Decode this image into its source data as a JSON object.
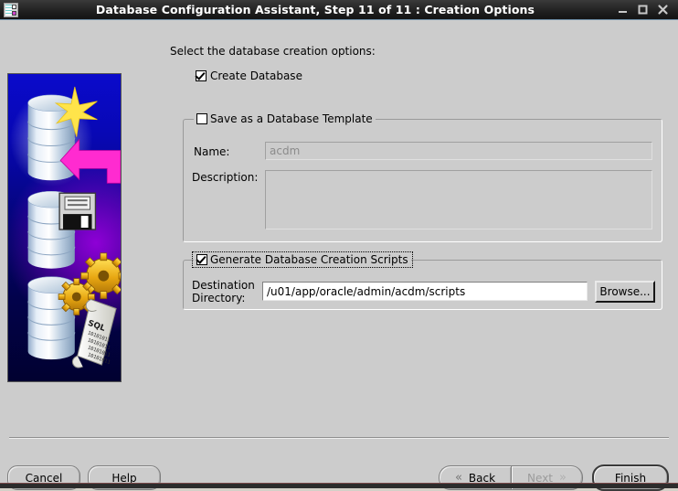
{
  "window": {
    "title": "Database Configuration Assistant, Step 11 of 11 : Creation Options",
    "icon": "database-assistant-icon",
    "minimize_label": "–",
    "maximize_label": "□",
    "close_label": "✕"
  },
  "main": {
    "intro_label": "Select the database creation options:",
    "create_database": {
      "label": "Create Database",
      "checked": true
    },
    "template_group": {
      "title": "Save as a Database Template",
      "checked": false,
      "name_label": "Name:",
      "name_value": "acdm",
      "name_enabled": false,
      "description_label": "Description:",
      "description_value": "",
      "description_enabled": false
    },
    "scripts_group": {
      "title": "Generate Database Creation Scripts",
      "checked": true,
      "focused": true,
      "destination_label_line1": "Destination",
      "destination_label_line2": "Directory:",
      "destination_value": "/u01/app/oracle/admin/acdm/scripts",
      "browse_label": "Browse..."
    }
  },
  "sidebar": {
    "image_alt": "oracle-database-creation-graphic",
    "scroll_text": "SQL"
  },
  "footer": {
    "cancel_label": "Cancel",
    "help_label": "Help",
    "back_label": "Back",
    "back_mnemonic": "B",
    "next_label": "Next",
    "next_mnemonic": "N",
    "next_enabled": false,
    "finish_label": "Finish",
    "finish_mnemonic": "F",
    "back_chevron": "«",
    "next_chevron": "»"
  },
  "colors": {
    "window_bg": "#cccccc",
    "titlebar_bg": "#1c1c1c",
    "titlebar_text": "#ffffff",
    "accent_arrow": "#ff2bd0",
    "sidebar_blue": "#0a0acb",
    "sidebar_purple": "#8a00dc",
    "disabled_text": "#8b8b8b"
  }
}
